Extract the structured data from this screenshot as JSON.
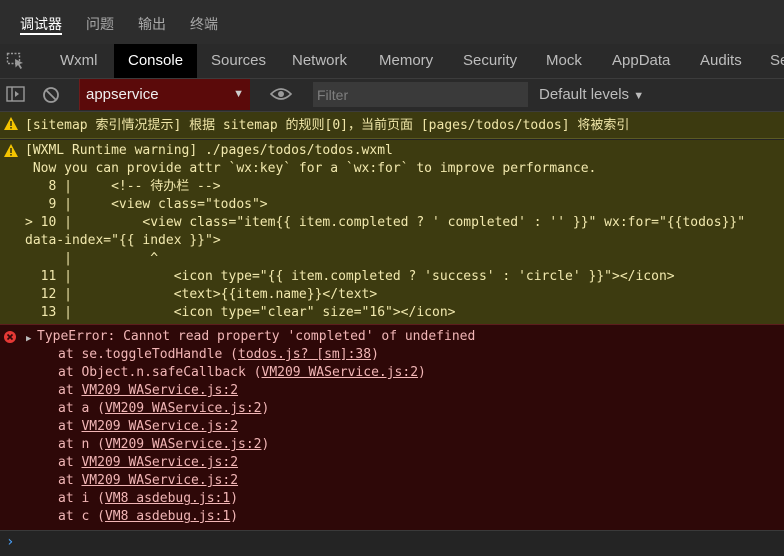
{
  "top_tabs": [
    "调试器",
    "问题",
    "输出",
    "终端"
  ],
  "dev_tabs": [
    "Wxml",
    "Console",
    "Sources",
    "Network",
    "Memory",
    "Security",
    "Mock",
    "AppData",
    "Audits",
    "Se"
  ],
  "toolbar": {
    "context": "appservice",
    "filter_placeholder": "Filter",
    "levels": "Default levels"
  },
  "messages": {
    "sitemap": "[sitemap 索引情况提示] 根据 sitemap 的规则[0]，当前页面 [pages/todos/todos] 将被索引",
    "wxml": [
      "[WXML Runtime warning] ./pages/todos/todos.wxml",
      " Now you can provide attr `wx:key` for a `wx:for` to improve performance.",
      "   8 |     <!-- 待办栏 -->",
      "   9 |     <view class=\"todos\">",
      "> 10 |         <view class=\"item{{ item.completed ? ' completed' : '' }}\" wx:for=\"{{todos}}\"",
      "data-index=\"{{ index }}\">",
      "     |          ^",
      "  11 |             <icon type=\"{{ item.completed ? 'success' : 'circle' }}\"></icon>",
      "  12 |             <text>{{item.name}}</text>",
      "  13 |             <icon type=\"clear\" size=\"16\"></icon>"
    ],
    "error_title": "TypeError: Cannot read property 'completed' of undefined",
    "stack": [
      {
        "prefix": "at se.toggleTodHandle (",
        "link": "todos.js? [sm]:38",
        "suffix": ")"
      },
      {
        "prefix": "at Object.n.safeCallback (",
        "link": "VM209 WAService.js:2",
        "suffix": ")"
      },
      {
        "prefix": "at ",
        "link": "VM209 WAService.js:2",
        "suffix": ""
      },
      {
        "prefix": "at a (",
        "link": "VM209 WAService.js:2",
        "suffix": ")"
      },
      {
        "prefix": "at ",
        "link": "VM209 WAService.js:2",
        "suffix": ""
      },
      {
        "prefix": "at n (",
        "link": "VM209 WAService.js:2",
        "suffix": ")"
      },
      {
        "prefix": "at ",
        "link": "VM209 WAService.js:2",
        "suffix": ""
      },
      {
        "prefix": "at ",
        "link": "VM209 WAService.js:2",
        "suffix": ""
      },
      {
        "prefix": "at i (",
        "link": "VM8 asdebug.js:1",
        "suffix": ")"
      },
      {
        "prefix": "at c (",
        "link": "VM8 asdebug.js:1",
        "suffix": ")"
      }
    ]
  },
  "icons": {
    "inspect": "inspect-icon",
    "sidebar": "sidebar-toggle-icon",
    "clear": "clear-console-icon",
    "eye": "eye-icon",
    "warning": "warning-icon",
    "error": "error-icon",
    "expand": "expand-triangle-icon",
    "prompt": "prompt-chevron-icon"
  },
  "colors": {
    "warning_bg": "#3c3a10",
    "error_bg": "#2e0808",
    "context_bg": "#5b0a0a"
  }
}
